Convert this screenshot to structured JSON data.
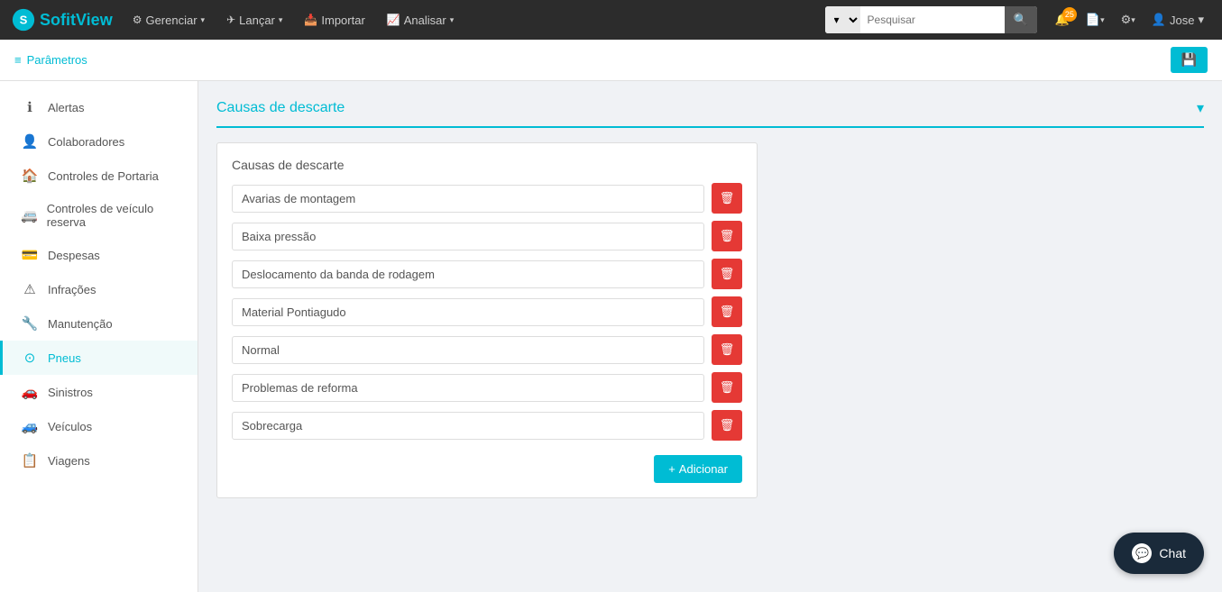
{
  "brand": {
    "name_part1": "Sofit",
    "name_part2": "View"
  },
  "navbar": {
    "items": [
      {
        "label": "Gerenciar",
        "has_caret": true
      },
      {
        "label": "Lançar",
        "has_caret": true
      },
      {
        "label": "Importar",
        "has_caret": false
      },
      {
        "label": "Analisar",
        "has_caret": true
      }
    ],
    "search_placeholder": "Pesquisar",
    "notification_count": "25",
    "user_name": "Jose"
  },
  "params_bar": {
    "link_label": "Parâmetros",
    "save_icon": "💾"
  },
  "sidebar": {
    "items": [
      {
        "label": "Alertas",
        "icon": "ℹ",
        "active": false
      },
      {
        "label": "Colaboradores",
        "icon": "👤",
        "active": false
      },
      {
        "label": "Controles de Portaria",
        "icon": "🏠",
        "active": false
      },
      {
        "label": "Controles de veículo reserva",
        "icon": "🏠",
        "active": false
      },
      {
        "label": "Despesas",
        "icon": "💳",
        "active": false
      },
      {
        "label": "Infrações",
        "icon": "⚠",
        "active": false
      },
      {
        "label": "Manutenção",
        "icon": "🔧",
        "active": false
      },
      {
        "label": "Pneus",
        "icon": "⊙",
        "active": true
      },
      {
        "label": "Sinistros",
        "icon": "🚗",
        "active": false
      },
      {
        "label": "Veículos",
        "icon": "🚗",
        "active": false
      },
      {
        "label": "Viagens",
        "icon": "📋",
        "active": false
      }
    ]
  },
  "main": {
    "section_title": "Causas de descarte",
    "card_title": "Causas de descarte",
    "items": [
      {
        "value": "Avarias de montagem"
      },
      {
        "value": "Baixa pressão"
      },
      {
        "value": "Deslocamento da banda de rodagem"
      },
      {
        "value": "Material Pontiagudo"
      },
      {
        "value": "Normal"
      },
      {
        "value": "Problemas de reforma"
      },
      {
        "value": "Sobrecarga"
      }
    ],
    "add_button_label": "+ Adicionar"
  },
  "chat": {
    "label": "Chat"
  }
}
